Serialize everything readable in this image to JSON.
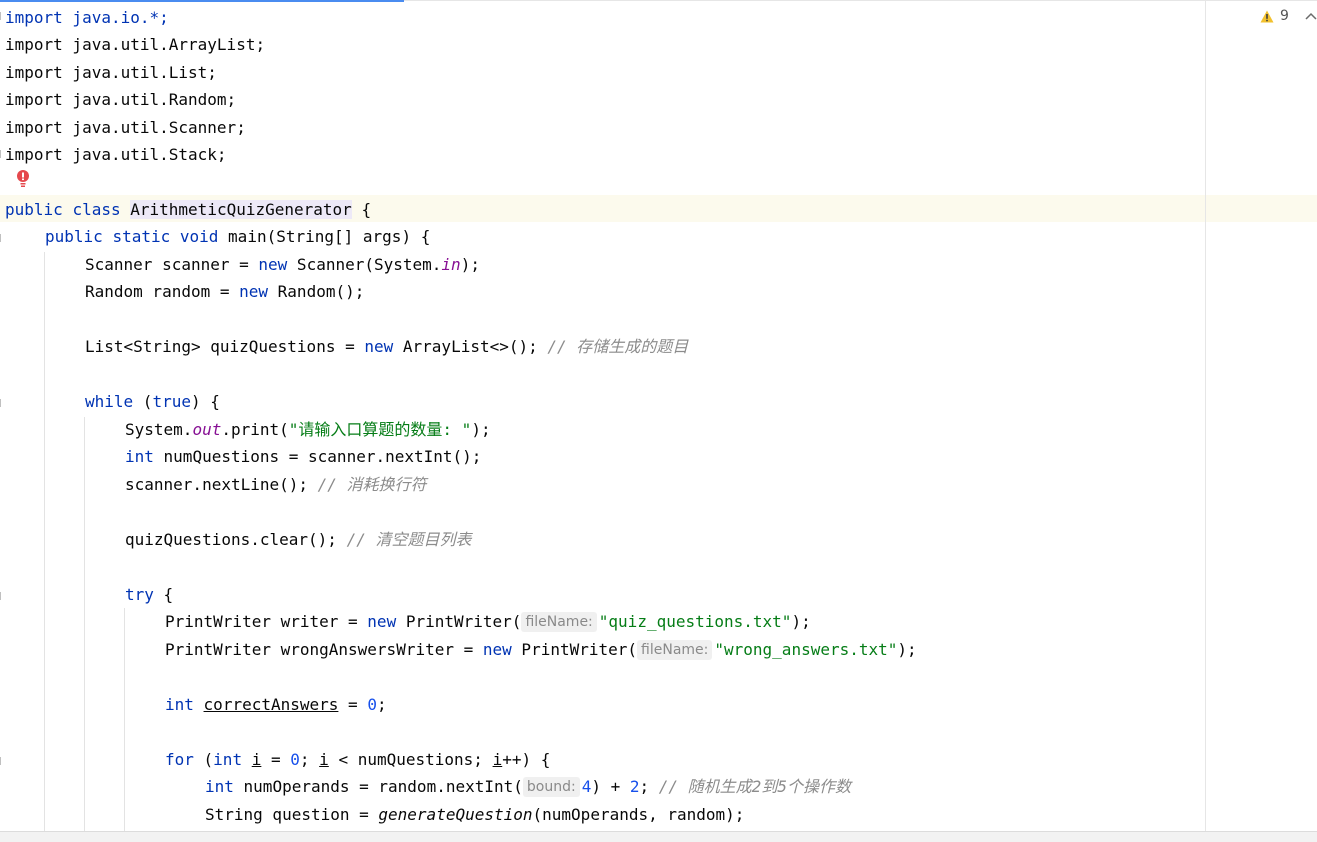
{
  "inspection": {
    "warning_icon": "warning-triangle-icon",
    "warning_count": "9",
    "nav_icon": "chevron-up-icon"
  },
  "gutter": {
    "error_icon": "error-bulb-icon"
  },
  "code": {
    "l1": "import java.io.*;",
    "l2": "import java.util.ArrayList;",
    "l3": "import java.util.List;",
    "l4": "import java.util.Random;",
    "l5": "import java.util.Scanner;",
    "l6": "import java.util.Stack;",
    "kw_public": "public",
    "kw_class": "class",
    "class_name": "ArithmeticQuizGenerator",
    "l8_rest": " {",
    "kw_static": "static",
    "kw_void": "void",
    "main_sig": "main(String[] args) {",
    "l10_a": "Scanner scanner = ",
    "kw_new": "new",
    "l10_b": " Scanner(System.",
    "l10_field": "in",
    "l10_c": ");",
    "l11_a": "Random random = ",
    "l11_b": " Random();",
    "l13_a": "List<String> quizQuestions = ",
    "l13_b": " ArrayList<>(); ",
    "l13_cmt": "// 存储生成的题目",
    "kw_while": "while",
    "l15_a": " (",
    "kw_true": "true",
    "l15_b": ") {",
    "l16_a": "System.",
    "l16_field": "out",
    "l16_b": ".print(",
    "l16_str": "\"请输入口算题的数量: \"",
    "l16_c": ");",
    "kw_int": "int",
    "l17_rest": " numQuestions = scanner.nextInt();",
    "l18_a": "scanner.nextLine(); ",
    "l18_cmt": "// 消耗换行符",
    "l20_a": "quizQuestions.clear(); ",
    "l20_cmt": "// 清空题目列表",
    "kw_try": "try",
    "l22_rest": " {",
    "l23_a": "PrintWriter writer = ",
    "l23_b": " PrintWriter(",
    "hint_filename": "fileName:",
    "l23_str": "\"quiz_questions.txt\"",
    "l23_c": ");",
    "l24_a": "PrintWriter wrongAnswersWriter = ",
    "l24_b": " PrintWriter(",
    "l24_str": "\"wrong_answers.txt\"",
    "l24_c": ");",
    "l26_var": "correctAnswers",
    "l26_eq": " = ",
    "zero": "0",
    "semi": ";",
    "kw_for": "for",
    "l28_a": " (",
    "l28_var_i": "i",
    "l28_b": " = ",
    "l28_c": "; ",
    "l28_d": " < numQuestions; ",
    "l28_e": "++) {",
    "l29_a": " numOperands = random.nextInt(",
    "hint_bound": "bound:",
    "four": "4",
    "l29_b": ") + ",
    "two": "2",
    "l29_c": "; ",
    "l29_cmt": "// 随机生成2到5个操作数",
    "l30_a": "String question = ",
    "l30_call": "generateQuestion",
    "l30_b": "(numOperands, random);"
  }
}
